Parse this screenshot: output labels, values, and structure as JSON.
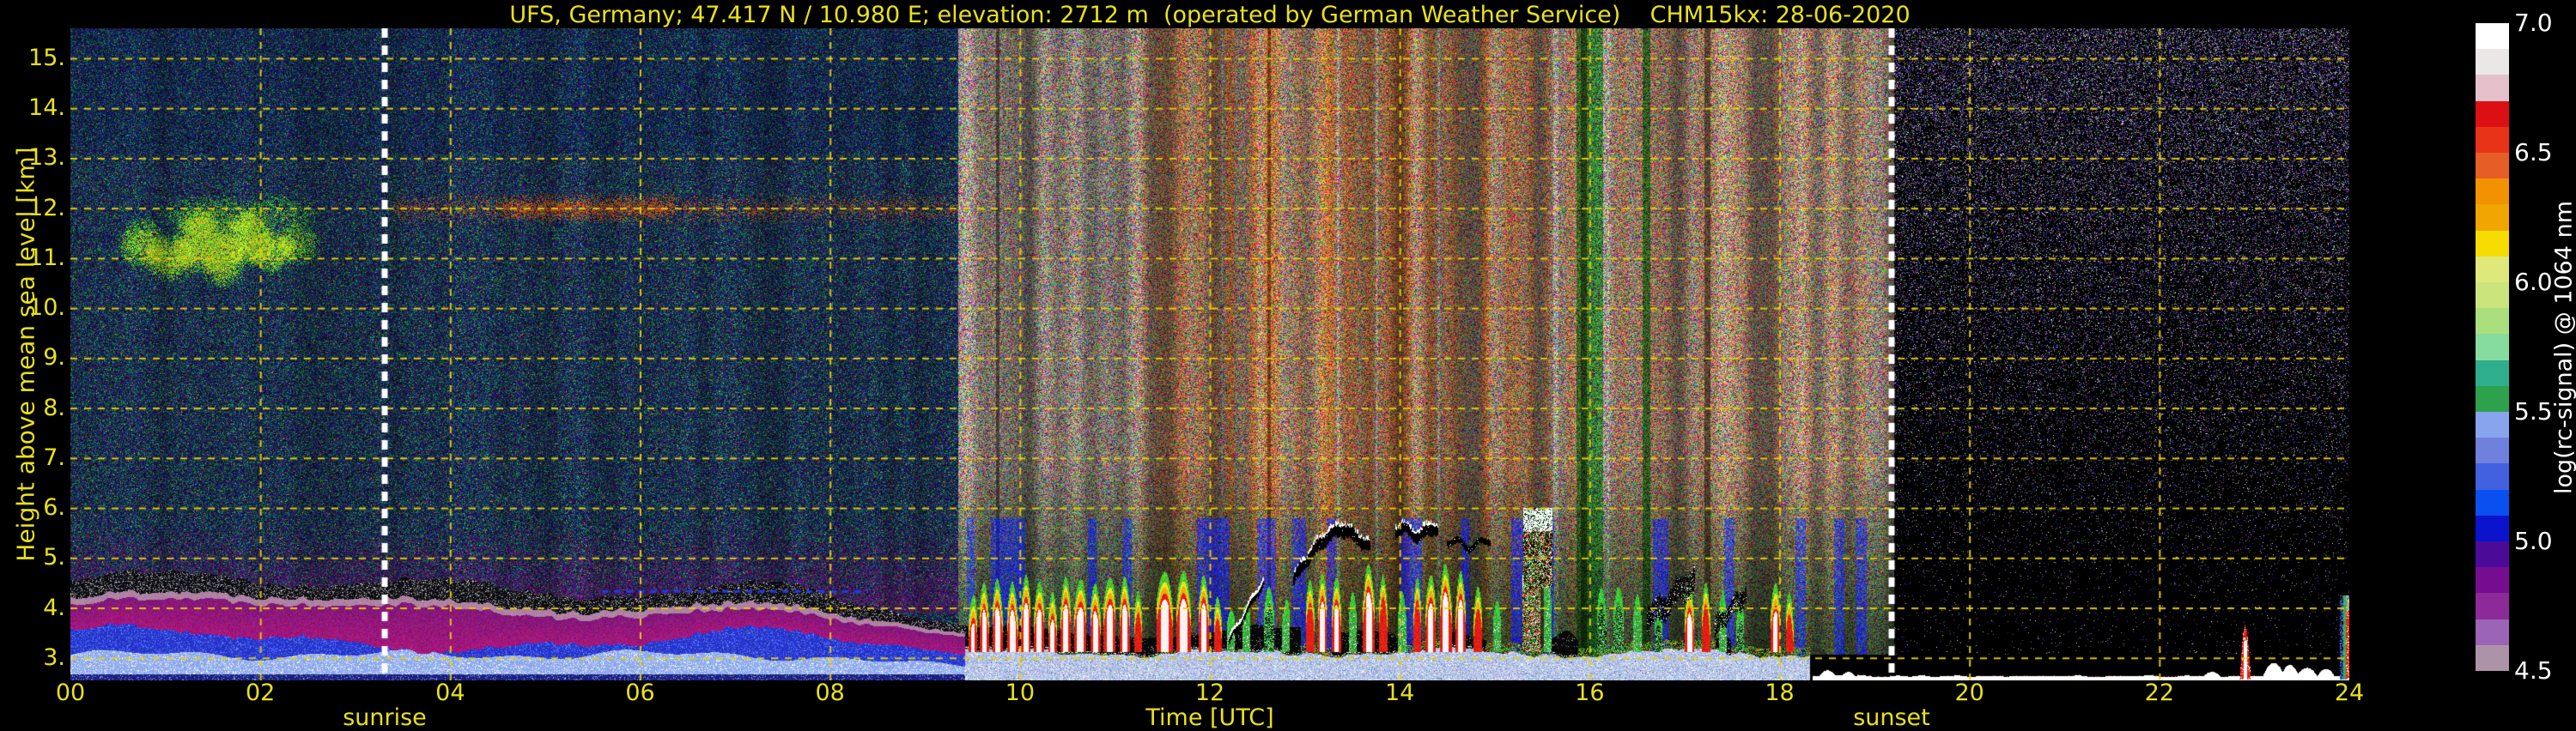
{
  "title": "UFS, Germany; 47.417 N / 10.980 E; elevation: 2712 m  (operated by German Weather Service)    CHM15kx: 28-06-2020",
  "plot": {
    "x_axis": {
      "title": "Time [UTC]",
      "tick_labels": [
        "00",
        "02",
        "04",
        "06",
        "08",
        "10",
        "12",
        "14",
        "16",
        "18",
        "20",
        "22",
        "24"
      ]
    },
    "y_axis": {
      "title": "Height above mean sea level [km]",
      "tick_labels": [
        "15.",
        "14.",
        "13.",
        "12.",
        "11.",
        "10.",
        "9.",
        "8.",
        "7.",
        "6.",
        "5.",
        "4.",
        "3."
      ]
    },
    "annotations": {
      "sunrise": {
        "label": "sunrise"
      },
      "sunset": {
        "label": "sunset"
      }
    }
  },
  "colorbar": {
    "title": "log(rc-signal) @ 1064 nm",
    "tick_labels": [
      "7.0",
      "6.5",
      "6.0",
      "5.5",
      "5.0",
      "4.5"
    ],
    "tick_values": [
      7.0,
      6.5,
      6.0,
      5.5,
      5.0,
      4.5
    ],
    "block_colors": [
      "#ffffff",
      "#ebe7e7",
      "#e4c0ca",
      "#dc1014",
      "#e93318",
      "#e65d25",
      "#f29200",
      "#f0a500",
      "#f6dc00",
      "#dfe87b",
      "#cbe47b",
      "#abdf7e",
      "#86dc9f",
      "#2fae8d",
      "#2da14c",
      "#88a4ec",
      "#7080dd",
      "#4161e0",
      "#0a50f0",
      "#0b13cc",
      "#4c0a99",
      "#760d91",
      "#8c2a9a",
      "#9c64b4",
      "#ad93a8"
    ]
  },
  "colors": {
    "background": "#000000",
    "label_yellow": "#e9e11b",
    "grid_yellow": "#e0c713",
    "sun_line_white": "#ffffff",
    "colorbar_text": "#ffffff"
  },
  "chart_data": {
    "type": "heatmap",
    "title": "UFS, Germany; 47.417 N / 10.980 E; elevation: 2712 m  (operated by German Weather Service)    CHM15kx: 28-06-2020",
    "xlabel": "Time [UTC]",
    "ylabel": "Height above mean sea level [km]",
    "x_range_hours": [
      0,
      24
    ],
    "x_ticks": [
      0,
      2,
      4,
      6,
      8,
      10,
      12,
      14,
      16,
      18,
      20,
      22,
      24
    ],
    "y_range_km": [
      2.55,
      15.6
    ],
    "y_ticks_km": [
      15,
      14,
      13,
      12,
      11,
      10,
      9,
      8,
      7,
      6,
      5,
      4,
      3
    ],
    "grid": true,
    "value_scale": {
      "label": "log(rc-signal) @ 1064 nm",
      "min": 4.5,
      "max": 7.0,
      "tick_step": 0.5
    },
    "sunrise_utc": 3.31,
    "sunset_utc": 19.18,
    "regions": [
      {
        "name": "night-morning-noise",
        "t_start": 0,
        "t_end": 9.35,
        "description": "dark blue/green/purple speckle background noise"
      },
      {
        "name": "daylight-solar-noise",
        "t_start": 9.35,
        "t_end": 19.2,
        "description": "bright white/gray RGB speckle with brown-orange column streaks, greener and darker below 7 km"
      },
      {
        "name": "night-evening-dark",
        "t_start": 19.2,
        "t_end": 24,
        "description": "black background with sparse purple/white speckle, denser with altitude"
      }
    ],
    "cirrus_cloud": {
      "t_start": 0.55,
      "t_end": 2.65,
      "z_bottom_km": 10.5,
      "z_top_km": 12.2,
      "blobs": [
        {
          "t": 0.75,
          "z": 11.3,
          "rt": 0.28,
          "rz": 0.55,
          "a": 0.75
        },
        {
          "t": 1.05,
          "z": 11.0,
          "rt": 0.3,
          "rz": 0.5,
          "a": 0.9
        },
        {
          "t": 1.35,
          "z": 11.35,
          "rt": 0.3,
          "rz": 0.7,
          "a": 0.9
        },
        {
          "t": 1.6,
          "z": 10.95,
          "rt": 0.25,
          "rz": 0.6,
          "a": 0.95
        },
        {
          "t": 1.85,
          "z": 11.4,
          "rt": 0.3,
          "rz": 0.6,
          "a": 0.9
        },
        {
          "t": 2.1,
          "z": 11.15,
          "rt": 0.28,
          "rz": 0.5,
          "a": 0.85
        },
        {
          "t": 2.4,
          "z": 11.3,
          "rt": 0.25,
          "rz": 0.45,
          "a": 0.7
        },
        {
          "t": 1.5,
          "z": 11.85,
          "rt": 0.6,
          "rz": 0.45,
          "a": 0.45
        },
        {
          "t": 2.2,
          "z": 11.9,
          "rt": 0.45,
          "rz": 0.4,
          "a": 0.4
        }
      ]
    },
    "elevated_layer": {
      "t_start": 3.4,
      "t_end": 9.3,
      "z_km": 12.0,
      "core_t_start": 4.55,
      "core_t_end": 6.35
    },
    "boundary_layer_bands": {
      "t_start": 0,
      "t_end": 9.56,
      "layers_bottom_to_top": [
        "dark blue floor ~2.6 km",
        "light blue 2.65-3.1 km",
        "royal blue to ~3.4 km",
        "magenta to ~4.0 km",
        "mauve fringe ~0.13 km",
        "black speckle band to ~4.4 km",
        "purple speckle haze to ~5.7 km"
      ],
      "blue_dotted_line": {
        "t_start": 5.6,
        "t_end": 8.4,
        "z_km": 4.33
      }
    },
    "day_surface_strip": {
      "t_start": 9.42,
      "t_end": 18.32,
      "z_top_km": 3.1,
      "description": "light blue-gray strip with white speckle, green/red speckle along top edge, black cloud band 3.2-3.6 km"
    },
    "precip_columns": [
      {
        "t": 9.5,
        "top": 4.3,
        "type": "rw",
        "w": 0.08
      },
      {
        "t": 9.62,
        "top": 4.5,
        "type": "rw",
        "w": 0.09
      },
      {
        "t": 9.76,
        "top": 4.55,
        "type": "rw",
        "w": 0.1
      },
      {
        "t": 9.92,
        "top": 4.5,
        "type": "rw",
        "w": 0.1
      },
      {
        "t": 10.06,
        "top": 4.6,
        "type": "rw",
        "w": 0.09
      },
      {
        "t": 10.2,
        "top": 4.5,
        "type": "rw",
        "w": 0.1
      },
      {
        "t": 10.34,
        "top": 4.35,
        "type": "rw",
        "w": 0.08
      },
      {
        "t": 10.48,
        "top": 4.6,
        "type": "rw",
        "w": 0.1
      },
      {
        "t": 10.63,
        "top": 4.55,
        "type": "rw",
        "w": 0.12
      },
      {
        "t": 10.79,
        "top": 4.5,
        "type": "rw",
        "w": 0.1
      },
      {
        "t": 10.94,
        "top": 4.6,
        "type": "rw",
        "w": 0.12
      },
      {
        "t": 11.1,
        "top": 4.55,
        "type": "rw",
        "w": 0.1
      },
      {
        "t": 11.24,
        "top": 4.35,
        "type": "r",
        "w": 0.07
      },
      {
        "t": 11.52,
        "top": 4.7,
        "type": "rw",
        "w": 0.16
      },
      {
        "t": 11.72,
        "top": 4.75,
        "type": "rw",
        "w": 0.14
      },
      {
        "t": 11.93,
        "top": 4.6,
        "type": "rw",
        "w": 0.1
      },
      {
        "t": 12.08,
        "top": 4.15,
        "type": "r",
        "w": 0.06
      },
      {
        "t": 12.22,
        "top": 3.9,
        "type": "g",
        "w": 0.05
      },
      {
        "t": 12.38,
        "top": 4.05,
        "type": "g",
        "w": 0.08
      },
      {
        "t": 12.62,
        "top": 4.45,
        "type": "gb",
        "w": 0.1
      },
      {
        "t": 12.8,
        "top": 4.2,
        "type": "g",
        "w": 0.06
      },
      {
        "t": 13.05,
        "top": 4.5,
        "type": "r",
        "w": 0.08
      },
      {
        "t": 13.18,
        "top": 4.65,
        "type": "rw",
        "w": 0.09
      },
      {
        "t": 13.33,
        "top": 4.6,
        "type": "rw",
        "w": 0.09
      },
      {
        "t": 13.5,
        "top": 4.35,
        "type": "g",
        "w": 0.07
      },
      {
        "t": 13.67,
        "top": 4.85,
        "type": "rw",
        "w": 0.12
      },
      {
        "t": 13.82,
        "top": 4.6,
        "type": "r",
        "w": 0.08
      },
      {
        "t": 14.02,
        "top": 4.4,
        "type": "g",
        "w": 0.08
      },
      {
        "t": 14.18,
        "top": 4.55,
        "type": "r",
        "w": 0.07
      },
      {
        "t": 14.32,
        "top": 4.7,
        "type": "rw",
        "w": 0.1
      },
      {
        "t": 14.48,
        "top": 4.85,
        "type": "rw",
        "w": 0.12
      },
      {
        "t": 14.64,
        "top": 4.7,
        "type": "rw",
        "w": 0.1
      },
      {
        "t": 14.82,
        "top": 4.45,
        "type": "r",
        "w": 0.08
      },
      {
        "t": 15.02,
        "top": 4.2,
        "type": "g",
        "w": 0.05
      },
      {
        "t": 15.38,
        "top": 5.85,
        "type": "tall",
        "w": 0.18
      },
      {
        "t": 15.55,
        "top": 5.2,
        "type": "g",
        "w": 0.07
      },
      {
        "t": 16.12,
        "top": 4.35,
        "type": "gb",
        "w": 0.09
      },
      {
        "t": 16.3,
        "top": 4.5,
        "type": "gb",
        "w": 0.1
      },
      {
        "t": 16.5,
        "top": 4.3,
        "type": "g",
        "w": 0.08
      },
      {
        "t": 16.72,
        "top": 4.0,
        "type": "gb",
        "w": 0.07
      },
      {
        "t": 17.05,
        "top": 4.45,
        "type": "rw",
        "w": 0.09
      },
      {
        "t": 17.22,
        "top": 4.55,
        "type": "r",
        "w": 0.08
      },
      {
        "t": 17.4,
        "top": 4.35,
        "type": "g",
        "w": 0.07
      },
      {
        "t": 17.58,
        "top": 4.1,
        "type": "gb",
        "w": 0.06
      },
      {
        "t": 17.95,
        "top": 4.5,
        "type": "rw",
        "w": 0.09
      },
      {
        "t": 18.1,
        "top": 4.3,
        "type": "r",
        "w": 0.07
      }
    ],
    "cloud_layers": [
      {
        "t_start": 12.2,
        "t_end": 12.56,
        "z_start": 3.35,
        "z_end": 4.55,
        "style": "white-black",
        "thick": 0.16
      },
      {
        "t_start": 12.88,
        "t_end": 13.68,
        "z_start": 4.55,
        "z_peak": 5.55,
        "z_end": 5.2,
        "style": "black-white-top",
        "thick": 0.22
      },
      {
        "t_start": 13.95,
        "t_end": 14.4,
        "z": 5.5,
        "style": "black-white-top",
        "thick": 0.2
      },
      {
        "t_start": 14.5,
        "t_end": 14.95,
        "z": 5.28,
        "style": "black-thin",
        "thick": 0.12
      },
      {
        "t_start": 15.3,
        "t_end": 15.6,
        "z_start": 4.4,
        "z_end": 6.0,
        "style": "tall-mixed"
      },
      {
        "t_start": 16.6,
        "t_end": 17.1,
        "z_start": 3.75,
        "z_end": 4.6,
        "style": "black-mottle",
        "thick": 0.45
      },
      {
        "t_start": 17.32,
        "t_end": 17.64,
        "z_start": 3.6,
        "z_end": 4.3,
        "style": "black-mottle",
        "thick": 0.35
      }
    ],
    "night_base_line": {
      "t_start": 18.35,
      "t_end": 24,
      "z_km": 2.62
    },
    "night_mounds": [
      {
        "t": 18.5,
        "z": 2.75,
        "w": 0.1
      },
      {
        "t": 18.72,
        "z": 2.72,
        "w": 0.08
      },
      {
        "t": 22.55,
        "z": 2.72,
        "w": 0.1
      },
      {
        "t": 23.2,
        "z": 2.9,
        "w": 0.12
      },
      {
        "t": 23.37,
        "z": 2.86,
        "w": 0.1
      },
      {
        "t": 23.55,
        "z": 2.8,
        "w": 0.12
      },
      {
        "t": 23.75,
        "z": 2.78,
        "w": 0.1
      }
    ],
    "night_spike": {
      "t": 22.9,
      "top_km": 3.62,
      "w": 0.11
    },
    "edge_column": {
      "t_start": 23.9,
      "t_end": 24.0,
      "top_km": 4.25
    }
  }
}
